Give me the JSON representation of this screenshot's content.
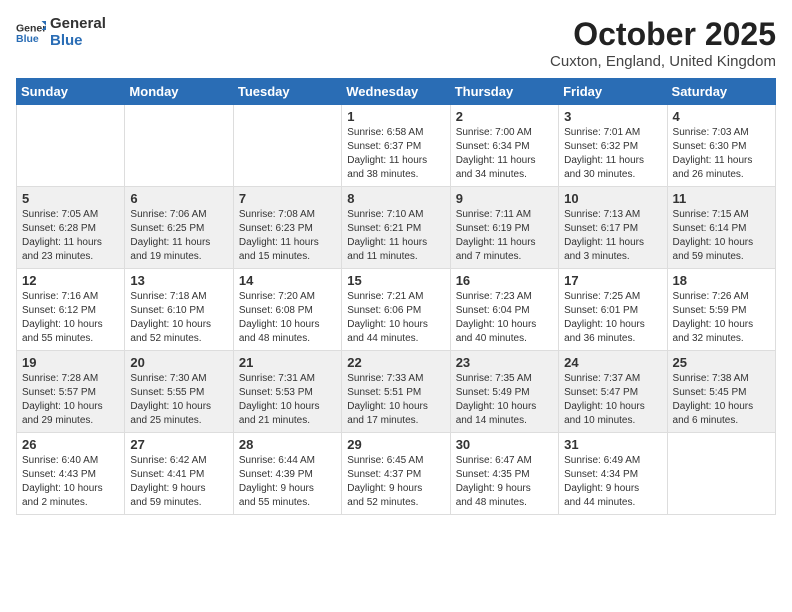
{
  "header": {
    "logo_general": "General",
    "logo_blue": "Blue",
    "month": "October 2025",
    "location": "Cuxton, England, United Kingdom"
  },
  "weekdays": [
    "Sunday",
    "Monday",
    "Tuesday",
    "Wednesday",
    "Thursday",
    "Friday",
    "Saturday"
  ],
  "weeks": [
    [
      {
        "day": "",
        "info": ""
      },
      {
        "day": "",
        "info": ""
      },
      {
        "day": "",
        "info": ""
      },
      {
        "day": "1",
        "info": "Sunrise: 6:58 AM\nSunset: 6:37 PM\nDaylight: 11 hours\nand 38 minutes."
      },
      {
        "day": "2",
        "info": "Sunrise: 7:00 AM\nSunset: 6:34 PM\nDaylight: 11 hours\nand 34 minutes."
      },
      {
        "day": "3",
        "info": "Sunrise: 7:01 AM\nSunset: 6:32 PM\nDaylight: 11 hours\nand 30 minutes."
      },
      {
        "day": "4",
        "info": "Sunrise: 7:03 AM\nSunset: 6:30 PM\nDaylight: 11 hours\nand 26 minutes."
      }
    ],
    [
      {
        "day": "5",
        "info": "Sunrise: 7:05 AM\nSunset: 6:28 PM\nDaylight: 11 hours\nand 23 minutes."
      },
      {
        "day": "6",
        "info": "Sunrise: 7:06 AM\nSunset: 6:25 PM\nDaylight: 11 hours\nand 19 minutes."
      },
      {
        "day": "7",
        "info": "Sunrise: 7:08 AM\nSunset: 6:23 PM\nDaylight: 11 hours\nand 15 minutes."
      },
      {
        "day": "8",
        "info": "Sunrise: 7:10 AM\nSunset: 6:21 PM\nDaylight: 11 hours\nand 11 minutes."
      },
      {
        "day": "9",
        "info": "Sunrise: 7:11 AM\nSunset: 6:19 PM\nDaylight: 11 hours\nand 7 minutes."
      },
      {
        "day": "10",
        "info": "Sunrise: 7:13 AM\nSunset: 6:17 PM\nDaylight: 11 hours\nand 3 minutes."
      },
      {
        "day": "11",
        "info": "Sunrise: 7:15 AM\nSunset: 6:14 PM\nDaylight: 10 hours\nand 59 minutes."
      }
    ],
    [
      {
        "day": "12",
        "info": "Sunrise: 7:16 AM\nSunset: 6:12 PM\nDaylight: 10 hours\nand 55 minutes."
      },
      {
        "day": "13",
        "info": "Sunrise: 7:18 AM\nSunset: 6:10 PM\nDaylight: 10 hours\nand 52 minutes."
      },
      {
        "day": "14",
        "info": "Sunrise: 7:20 AM\nSunset: 6:08 PM\nDaylight: 10 hours\nand 48 minutes."
      },
      {
        "day": "15",
        "info": "Sunrise: 7:21 AM\nSunset: 6:06 PM\nDaylight: 10 hours\nand 44 minutes."
      },
      {
        "day": "16",
        "info": "Sunrise: 7:23 AM\nSunset: 6:04 PM\nDaylight: 10 hours\nand 40 minutes."
      },
      {
        "day": "17",
        "info": "Sunrise: 7:25 AM\nSunset: 6:01 PM\nDaylight: 10 hours\nand 36 minutes."
      },
      {
        "day": "18",
        "info": "Sunrise: 7:26 AM\nSunset: 5:59 PM\nDaylight: 10 hours\nand 32 minutes."
      }
    ],
    [
      {
        "day": "19",
        "info": "Sunrise: 7:28 AM\nSunset: 5:57 PM\nDaylight: 10 hours\nand 29 minutes."
      },
      {
        "day": "20",
        "info": "Sunrise: 7:30 AM\nSunset: 5:55 PM\nDaylight: 10 hours\nand 25 minutes."
      },
      {
        "day": "21",
        "info": "Sunrise: 7:31 AM\nSunset: 5:53 PM\nDaylight: 10 hours\nand 21 minutes."
      },
      {
        "day": "22",
        "info": "Sunrise: 7:33 AM\nSunset: 5:51 PM\nDaylight: 10 hours\nand 17 minutes."
      },
      {
        "day": "23",
        "info": "Sunrise: 7:35 AM\nSunset: 5:49 PM\nDaylight: 10 hours\nand 14 minutes."
      },
      {
        "day": "24",
        "info": "Sunrise: 7:37 AM\nSunset: 5:47 PM\nDaylight: 10 hours\nand 10 minutes."
      },
      {
        "day": "25",
        "info": "Sunrise: 7:38 AM\nSunset: 5:45 PM\nDaylight: 10 hours\nand 6 minutes."
      }
    ],
    [
      {
        "day": "26",
        "info": "Sunrise: 6:40 AM\nSunset: 4:43 PM\nDaylight: 10 hours\nand 2 minutes."
      },
      {
        "day": "27",
        "info": "Sunrise: 6:42 AM\nSunset: 4:41 PM\nDaylight: 9 hours\nand 59 minutes."
      },
      {
        "day": "28",
        "info": "Sunrise: 6:44 AM\nSunset: 4:39 PM\nDaylight: 9 hours\nand 55 minutes."
      },
      {
        "day": "29",
        "info": "Sunrise: 6:45 AM\nSunset: 4:37 PM\nDaylight: 9 hours\nand 52 minutes."
      },
      {
        "day": "30",
        "info": "Sunrise: 6:47 AM\nSunset: 4:35 PM\nDaylight: 9 hours\nand 48 minutes."
      },
      {
        "day": "31",
        "info": "Sunrise: 6:49 AM\nSunset: 4:34 PM\nDaylight: 9 hours\nand 44 minutes."
      },
      {
        "day": "",
        "info": ""
      }
    ]
  ]
}
